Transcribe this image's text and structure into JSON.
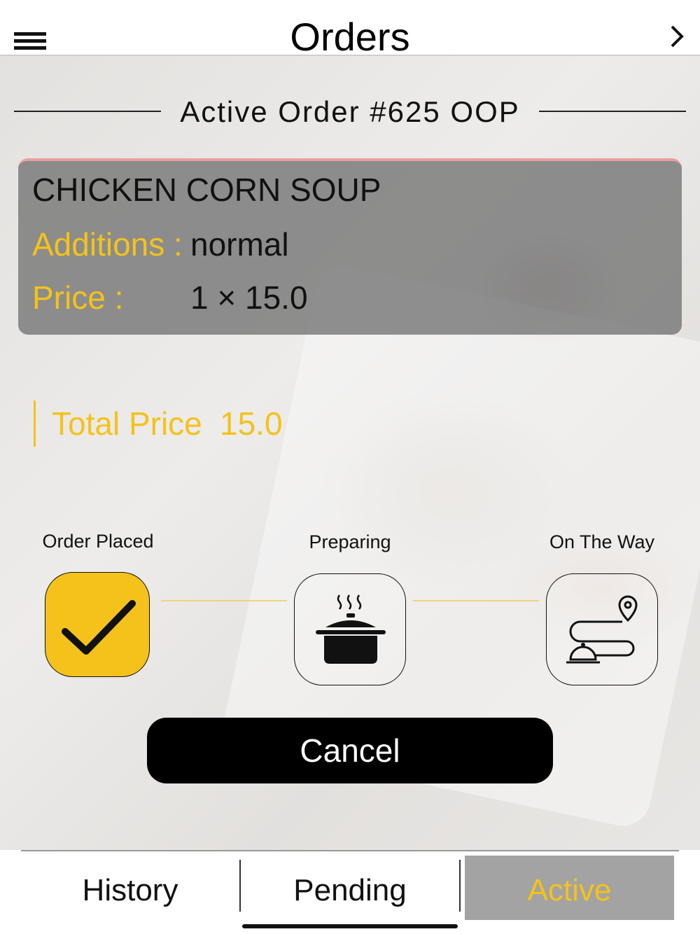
{
  "header": {
    "title": "Orders"
  },
  "order": {
    "heading": "Active Order #625 OOP",
    "item_name": "CHICKEN CORN SOUP",
    "additions_label": "Additions :",
    "additions_value": "normal",
    "price_label": "Price :",
    "price_value": "1 × 15.0"
  },
  "total": {
    "label": "Total Price",
    "value": "15.0"
  },
  "steps": [
    {
      "label": "Order Placed",
      "icon": "checkmark-icon",
      "completed": true
    },
    {
      "label": "Preparing",
      "icon": "cooking-pot-icon",
      "completed": false
    },
    {
      "label": "On The Way",
      "icon": "delivery-route-icon",
      "completed": false
    }
  ],
  "cancel_label": "Cancel",
  "tabs": [
    {
      "label": "History",
      "active": false
    },
    {
      "label": "Pending",
      "active": false
    },
    {
      "label": "Active",
      "active": true
    }
  ],
  "colors": {
    "accent": "#f4c21a",
    "button": "#000000",
    "active_tab_bg": "#a3a3a3"
  }
}
